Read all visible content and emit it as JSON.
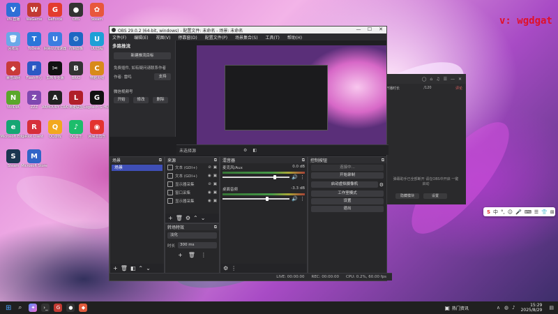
{
  "watermark": "v: wgdgat",
  "desktop_icons": [
    {
      "label": "VN 直播",
      "color": "#2e6fd6",
      "glyph": "V"
    },
    {
      "label": "WeGame",
      "color": "#c23a33",
      "glyph": "W"
    },
    {
      "label": "GeForce",
      "color": "#e33b2e",
      "glyph": "G"
    },
    {
      "label": "OBS",
      "color": "#333",
      "glyph": "●"
    },
    {
      "label": "Steam",
      "color": "#e8573c",
      "glyph": "✿"
    },
    {
      "label": "回收站",
      "color": "#6aa8e8",
      "glyph": "🗑"
    },
    {
      "label": "ToDesk",
      "color": "#2a75d9",
      "glyph": "T"
    },
    {
      "label": "网易UU加速器",
      "color": "#3b7de0",
      "glyph": "U"
    },
    {
      "label": "控制面板",
      "color": "#1d67c2",
      "glyph": "⚙"
    },
    {
      "label": "UU远程",
      "color": "#1ea0d6",
      "glyph": "U"
    },
    {
      "label": "暴雪战网",
      "color": "#c83a3a",
      "glyph": "◆"
    },
    {
      "label": "Flash中心",
      "color": "#2b58c4",
      "glyph": "F"
    },
    {
      "label": "剪映专业版",
      "color": "#111",
      "glyph": "✂"
    },
    {
      "label": "BRIO",
      "color": "#333",
      "glyph": "B"
    },
    {
      "label": "穿越火线",
      "color": "#d88a1a",
      "glyph": "C"
    },
    {
      "label": "NVIDIA",
      "color": "#5aa72b",
      "glyph": "N"
    },
    {
      "label": "ZZZ",
      "color": "#7f48b0",
      "glyph": "Z"
    },
    {
      "label": "ARMOURY CRATE",
      "color": "#222",
      "glyph": "A"
    },
    {
      "label": "英雄联盟",
      "color": "#b01e2a",
      "glyph": "L"
    },
    {
      "label": "Logitech G HUB",
      "color": "#111",
      "glyph": "G"
    },
    {
      "label": "Microsoft Edge",
      "color": "#17a673",
      "glyph": "e"
    },
    {
      "label": "Riot Client",
      "color": "#d62f3b",
      "glyph": "R"
    },
    {
      "label": "QQ游戏",
      "color": "#f2a81e",
      "glyph": "Q"
    },
    {
      "label": "QQ音乐",
      "color": "#1cbd6b",
      "glyph": "♪"
    },
    {
      "label": "网易云音乐",
      "color": "#e3332f",
      "glyph": "◉"
    },
    {
      "label": "Steam",
      "color": "#1a3650",
      "glyph": "S"
    },
    {
      "label": "Microsoft Store",
      "color": "#3164c7",
      "glyph": "M"
    }
  ],
  "bg_app": {
    "top_icons": [
      "◯",
      "⌂",
      "♫",
      "☰",
      "—",
      "✕"
    ],
    "row_left": "开播时长",
    "row_mid": "/120",
    "row_right": "评论",
    "message": "弹幕助手已全部断开 请在OBS中开启 一键启动",
    "btn1": "隐藏模块",
    "btn2": "设置"
  },
  "ime": {
    "logo": "S",
    "items": [
      "中",
      "°,",
      "☺",
      "🎤",
      "⌨",
      "☰",
      "👕",
      "⊞"
    ]
  },
  "obs": {
    "title": "OBS 29.0.2 (64-bit, windows) - 配置文件: 未命名 - 场景: 未命名",
    "menu": [
      "文件(F)",
      "编辑(E)",
      "视图(V)",
      "停靠窗(D)",
      "配置文件(P)",
      "场景集合(S)",
      "工具(T)",
      "帮助(H)"
    ],
    "plugin": {
      "title": "多路推流",
      "new_target": "新建推流目标",
      "note": "免费插件, 如有疑问请联系作者",
      "author_label": "作者: 雷鸣",
      "support": "支持",
      "account_label": "微信视频号",
      "start": "开始",
      "edit": "修改",
      "delete": "删除"
    },
    "no_source": "未选择源",
    "scenes": {
      "title": "场景",
      "items": [
        "场景"
      ]
    },
    "sources": {
      "title": "来源",
      "items": [
        {
          "name": "文本 (GDI+)"
        },
        {
          "name": "文本 (GDI+)"
        },
        {
          "name": "显示器采集"
        },
        {
          "name": "窗口采集"
        },
        {
          "name": "显示器采集"
        }
      ]
    },
    "mixer": {
      "title": "混音器",
      "channels": [
        {
          "name": "麦克风/Aux",
          "db": "0.0 dB",
          "level": 0.78
        },
        {
          "name": "桌面音频",
          "db": "-3.3 dB",
          "level": 0.66
        }
      ]
    },
    "transitions": {
      "title": "转场特效",
      "type": "淡化",
      "duration_label": "时长",
      "duration": "300 ms"
    },
    "controls": {
      "title": "控制按钮",
      "buttons": [
        "连接中...",
        "开始录制",
        "启动虚拟摄像机",
        "工作室模式",
        "设置",
        "退出"
      ]
    },
    "status": {
      "live": "LIVE: 00:00:00",
      "rec": "REC: 00:00:00",
      "cpu": "CPU: 0.2%, 60.00 fps"
    }
  },
  "taskbar": {
    "news": "热门资讯",
    "time": "15:29",
    "date": "2025/8/29"
  }
}
